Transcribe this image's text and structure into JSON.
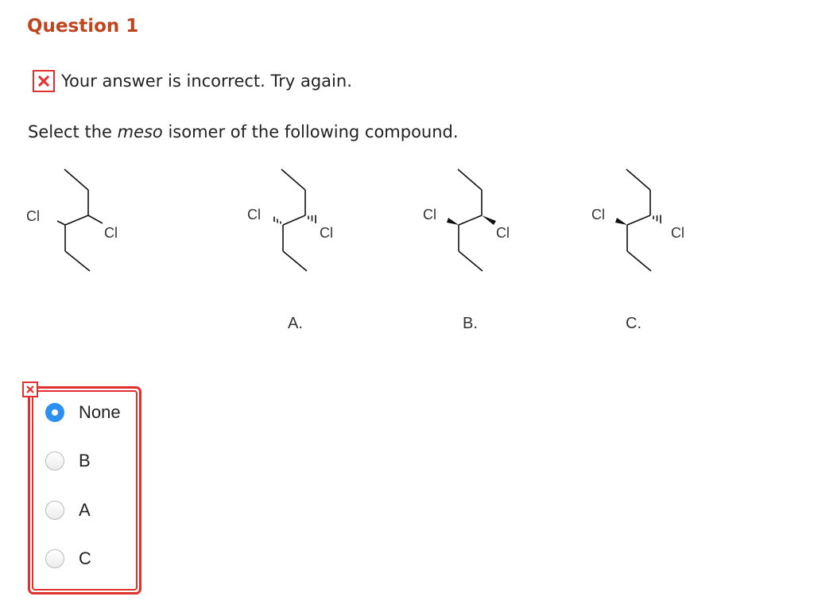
{
  "question": {
    "title": "Question 1",
    "feedback": "Your answer is incorrect.  Try again.",
    "prompt_before": "Select the ",
    "prompt_emphasis": "meso",
    "prompt_after": " isomer of the following compound."
  },
  "structures": {
    "atom_label": "Cl",
    "captions": [
      "A.",
      "B.",
      "C."
    ]
  },
  "answers": {
    "options": [
      {
        "label": "None",
        "selected": true
      },
      {
        "label": "B",
        "selected": false
      },
      {
        "label": "A",
        "selected": false
      },
      {
        "label": "C",
        "selected": false
      }
    ]
  },
  "colors": {
    "title": "#c0441d",
    "error": "#e0312f",
    "radio_selected": "#2d8ff0"
  },
  "icons": {
    "feedback": "close-x-icon",
    "answer_flag": "close-x-icon"
  }
}
